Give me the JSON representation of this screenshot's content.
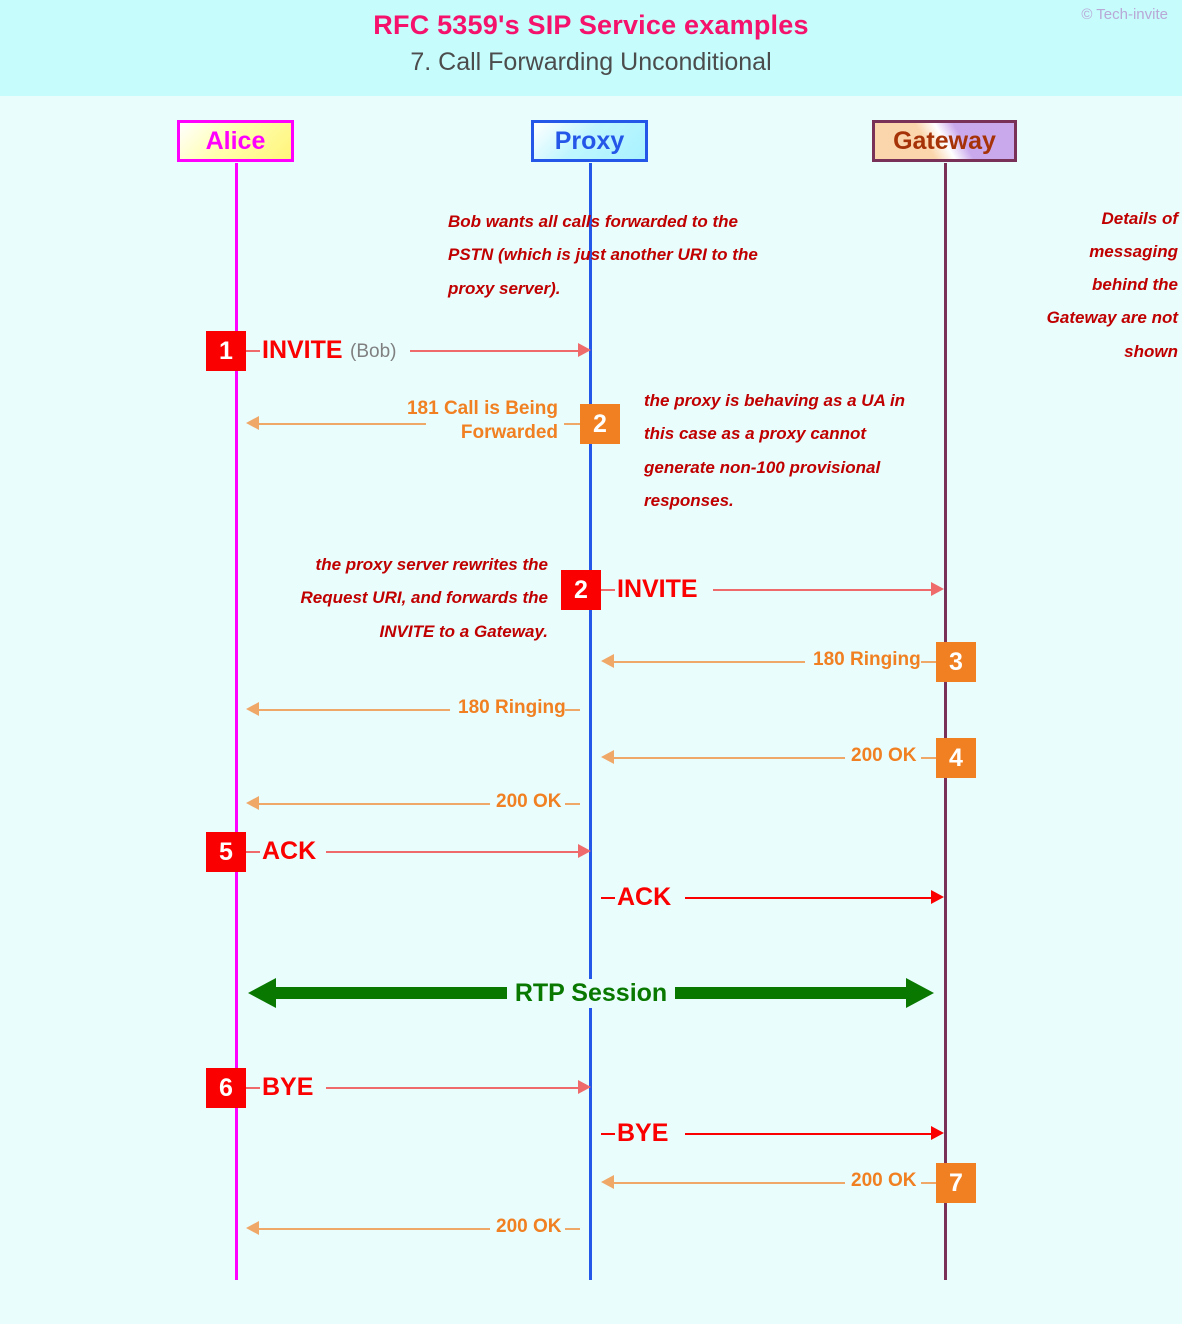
{
  "header": {
    "title": "RFC 5359's SIP Service examples",
    "subtitle": "7. Call Forwarding Unconditional",
    "copyright": "© Tech-invite",
    "title_color": "#f4126c",
    "subtitle_color": "#4c4c4c",
    "background": "#c6fcfc"
  },
  "actors": [
    {
      "id": "alice",
      "label": "Alice",
      "border": "#ff00ff",
      "text": "#ff00ff",
      "lifeline": "#ff00ff"
    },
    {
      "id": "proxy",
      "label": "Proxy",
      "border": "#2456e8",
      "text": "#2456e8",
      "lifeline": "#2456e8"
    },
    {
      "id": "gateway",
      "label": "Gateway",
      "border": "#7a3158",
      "text": "#a63208",
      "lifeline": "#7a3158"
    }
  ],
  "notes": {
    "bob_forward": "Bob wants all calls forwarded to the PSTN (which is just another URI to the proxy server).",
    "proxy_ua": "the proxy is behaving as a UA in this case as a proxy cannot generate non-100 provisional responses.",
    "proxy_rewrite": "the proxy server rewrites the Request URI, and forwards the INVITE to a Gateway.",
    "gateway_hidden": "Details of messaging behind the Gateway are not shown",
    "color": "#c00000"
  },
  "messages": [
    {
      "step": "1",
      "badge_color": "red",
      "label": "INVITE",
      "extra": "(Bob)",
      "from": "alice",
      "to": "proxy",
      "direction": "right",
      "style": "request"
    },
    {
      "step": "2",
      "badge_color": "orange",
      "label": "181 Call is Being Forwarded",
      "from": "proxy",
      "to": "alice",
      "direction": "left",
      "style": "response"
    },
    {
      "step": "2",
      "badge_color": "red",
      "label": "INVITE",
      "from": "proxy",
      "to": "gateway",
      "direction": "right",
      "style": "request"
    },
    {
      "step": "3",
      "badge_color": "orange",
      "label": "180 Ringing",
      "from": "gateway",
      "to": "proxy",
      "direction": "left",
      "style": "response"
    },
    {
      "step": "",
      "badge_color": "none",
      "label": "180 Ringing",
      "from": "proxy",
      "to": "alice",
      "direction": "left",
      "style": "response"
    },
    {
      "step": "4",
      "badge_color": "orange",
      "label": "200 OK",
      "from": "gateway",
      "to": "proxy",
      "direction": "left",
      "style": "response"
    },
    {
      "step": "",
      "badge_color": "none",
      "label": "200 OK",
      "from": "proxy",
      "to": "alice",
      "direction": "left",
      "style": "response"
    },
    {
      "step": "5",
      "badge_color": "red",
      "label": "ACK",
      "from": "alice",
      "to": "proxy",
      "direction": "right",
      "style": "request"
    },
    {
      "step": "",
      "badge_color": "none",
      "label": "ACK",
      "from": "proxy",
      "to": "gateway",
      "direction": "right",
      "style": "request"
    },
    {
      "step": "",
      "badge_color": "none",
      "label": "RTP Session",
      "from": "alice",
      "to": "gateway",
      "direction": "both",
      "style": "media"
    },
    {
      "step": "6",
      "badge_color": "red",
      "label": "BYE",
      "from": "alice",
      "to": "proxy",
      "direction": "right",
      "style": "request"
    },
    {
      "step": "",
      "badge_color": "none",
      "label": "BYE",
      "from": "proxy",
      "to": "gateway",
      "direction": "right",
      "style": "request"
    },
    {
      "step": "7",
      "badge_color": "orange",
      "label": "200 OK",
      "from": "gateway",
      "to": "proxy",
      "direction": "left",
      "style": "response"
    },
    {
      "step": "",
      "badge_color": "none",
      "label": "200 OK",
      "from": "proxy",
      "to": "alice",
      "direction": "left",
      "style": "response"
    }
  ],
  "labels": {
    "m1_invite": "INVITE",
    "m1_extra": "(Bob)",
    "m2_181_l1": "181 Call is Being",
    "m2_181_l2": "Forwarded",
    "m3_invite": "INVITE",
    "m4_180": "180 Ringing",
    "m5_180": "180 Ringing",
    "m6_200": "200 OK",
    "m7_200": "200 OK",
    "m8_ack": "ACK",
    "m9_ack": "ACK",
    "rtp": "RTP Session",
    "m11_bye": "BYE",
    "m12_bye": "BYE",
    "m13_200": "200 OK",
    "m14_200": "200 OK"
  },
  "badges": {
    "b1": "1",
    "b2": "2",
    "b2b": "2",
    "b3": "3",
    "b4": "4",
    "b5": "5",
    "b6": "6",
    "b7": "7"
  },
  "colors": {
    "request_red": "#fa0000",
    "request_line": "#ef6a6a",
    "response_orange": "#f08022",
    "response_line": "#f0a868",
    "media_green": "#087800",
    "note_red": "#c00000",
    "gray": "#808080",
    "page_bg": "#e9fdfd"
  }
}
